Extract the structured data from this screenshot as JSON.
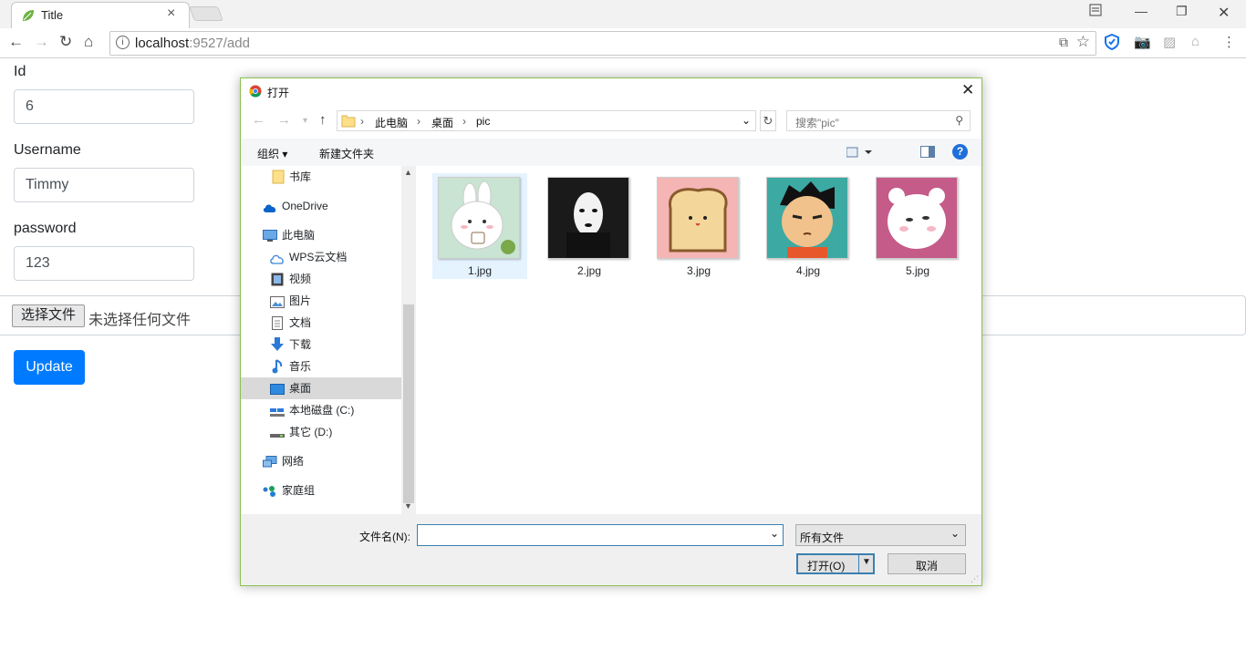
{
  "browser": {
    "tab_title": "Title",
    "url_host": "localhost",
    "url_path": ":9527/add"
  },
  "form": {
    "id_label": "Id",
    "id_value": "6",
    "username_label": "Username",
    "username_value": "Timmy",
    "password_label": "password",
    "password_value": "123",
    "file_button": "选择文件",
    "file_status": "未选择任何文件",
    "update_button": "Update"
  },
  "dialog": {
    "title": "打开",
    "breadcrumb": [
      "此电脑",
      "桌面",
      "pic"
    ],
    "search_placeholder": "搜索\"pic\"",
    "organize": "组织 ▾",
    "new_folder": "新建文件夹",
    "tree": [
      {
        "label": "书库",
        "icon": "folder-icon"
      },
      {
        "label": "OneDrive",
        "icon": "cloud-icon"
      },
      {
        "label": "此电脑",
        "icon": "computer-icon"
      },
      {
        "label": "WPS云文档",
        "icon": "cloud-outline-icon"
      },
      {
        "label": "视频",
        "icon": "video-icon"
      },
      {
        "label": "图片",
        "icon": "picture-icon"
      },
      {
        "label": "文档",
        "icon": "document-icon"
      },
      {
        "label": "下载",
        "icon": "download-icon"
      },
      {
        "label": "音乐",
        "icon": "music-icon"
      },
      {
        "label": "桌面",
        "icon": "desktop-icon"
      },
      {
        "label": "本地磁盘 (C:)",
        "icon": "drive-icon"
      },
      {
        "label": "其它 (D:)",
        "icon": "drive-icon"
      },
      {
        "label": "网络",
        "icon": "network-icon"
      },
      {
        "label": "家庭组",
        "icon": "homegroup-icon"
      }
    ],
    "files": [
      "1.jpg",
      "2.jpg",
      "3.jpg",
      "4.jpg",
      "5.jpg"
    ],
    "filename_label": "文件名(N):",
    "filename_value": "",
    "filetype": "所有文件",
    "open_button": "打开(O)",
    "cancel_button": "取消"
  },
  "colors": {
    "primary": "#007bff",
    "dialog_border": "#8cc152",
    "selection": "#cce8ff",
    "focus": "#3c7fb1"
  }
}
